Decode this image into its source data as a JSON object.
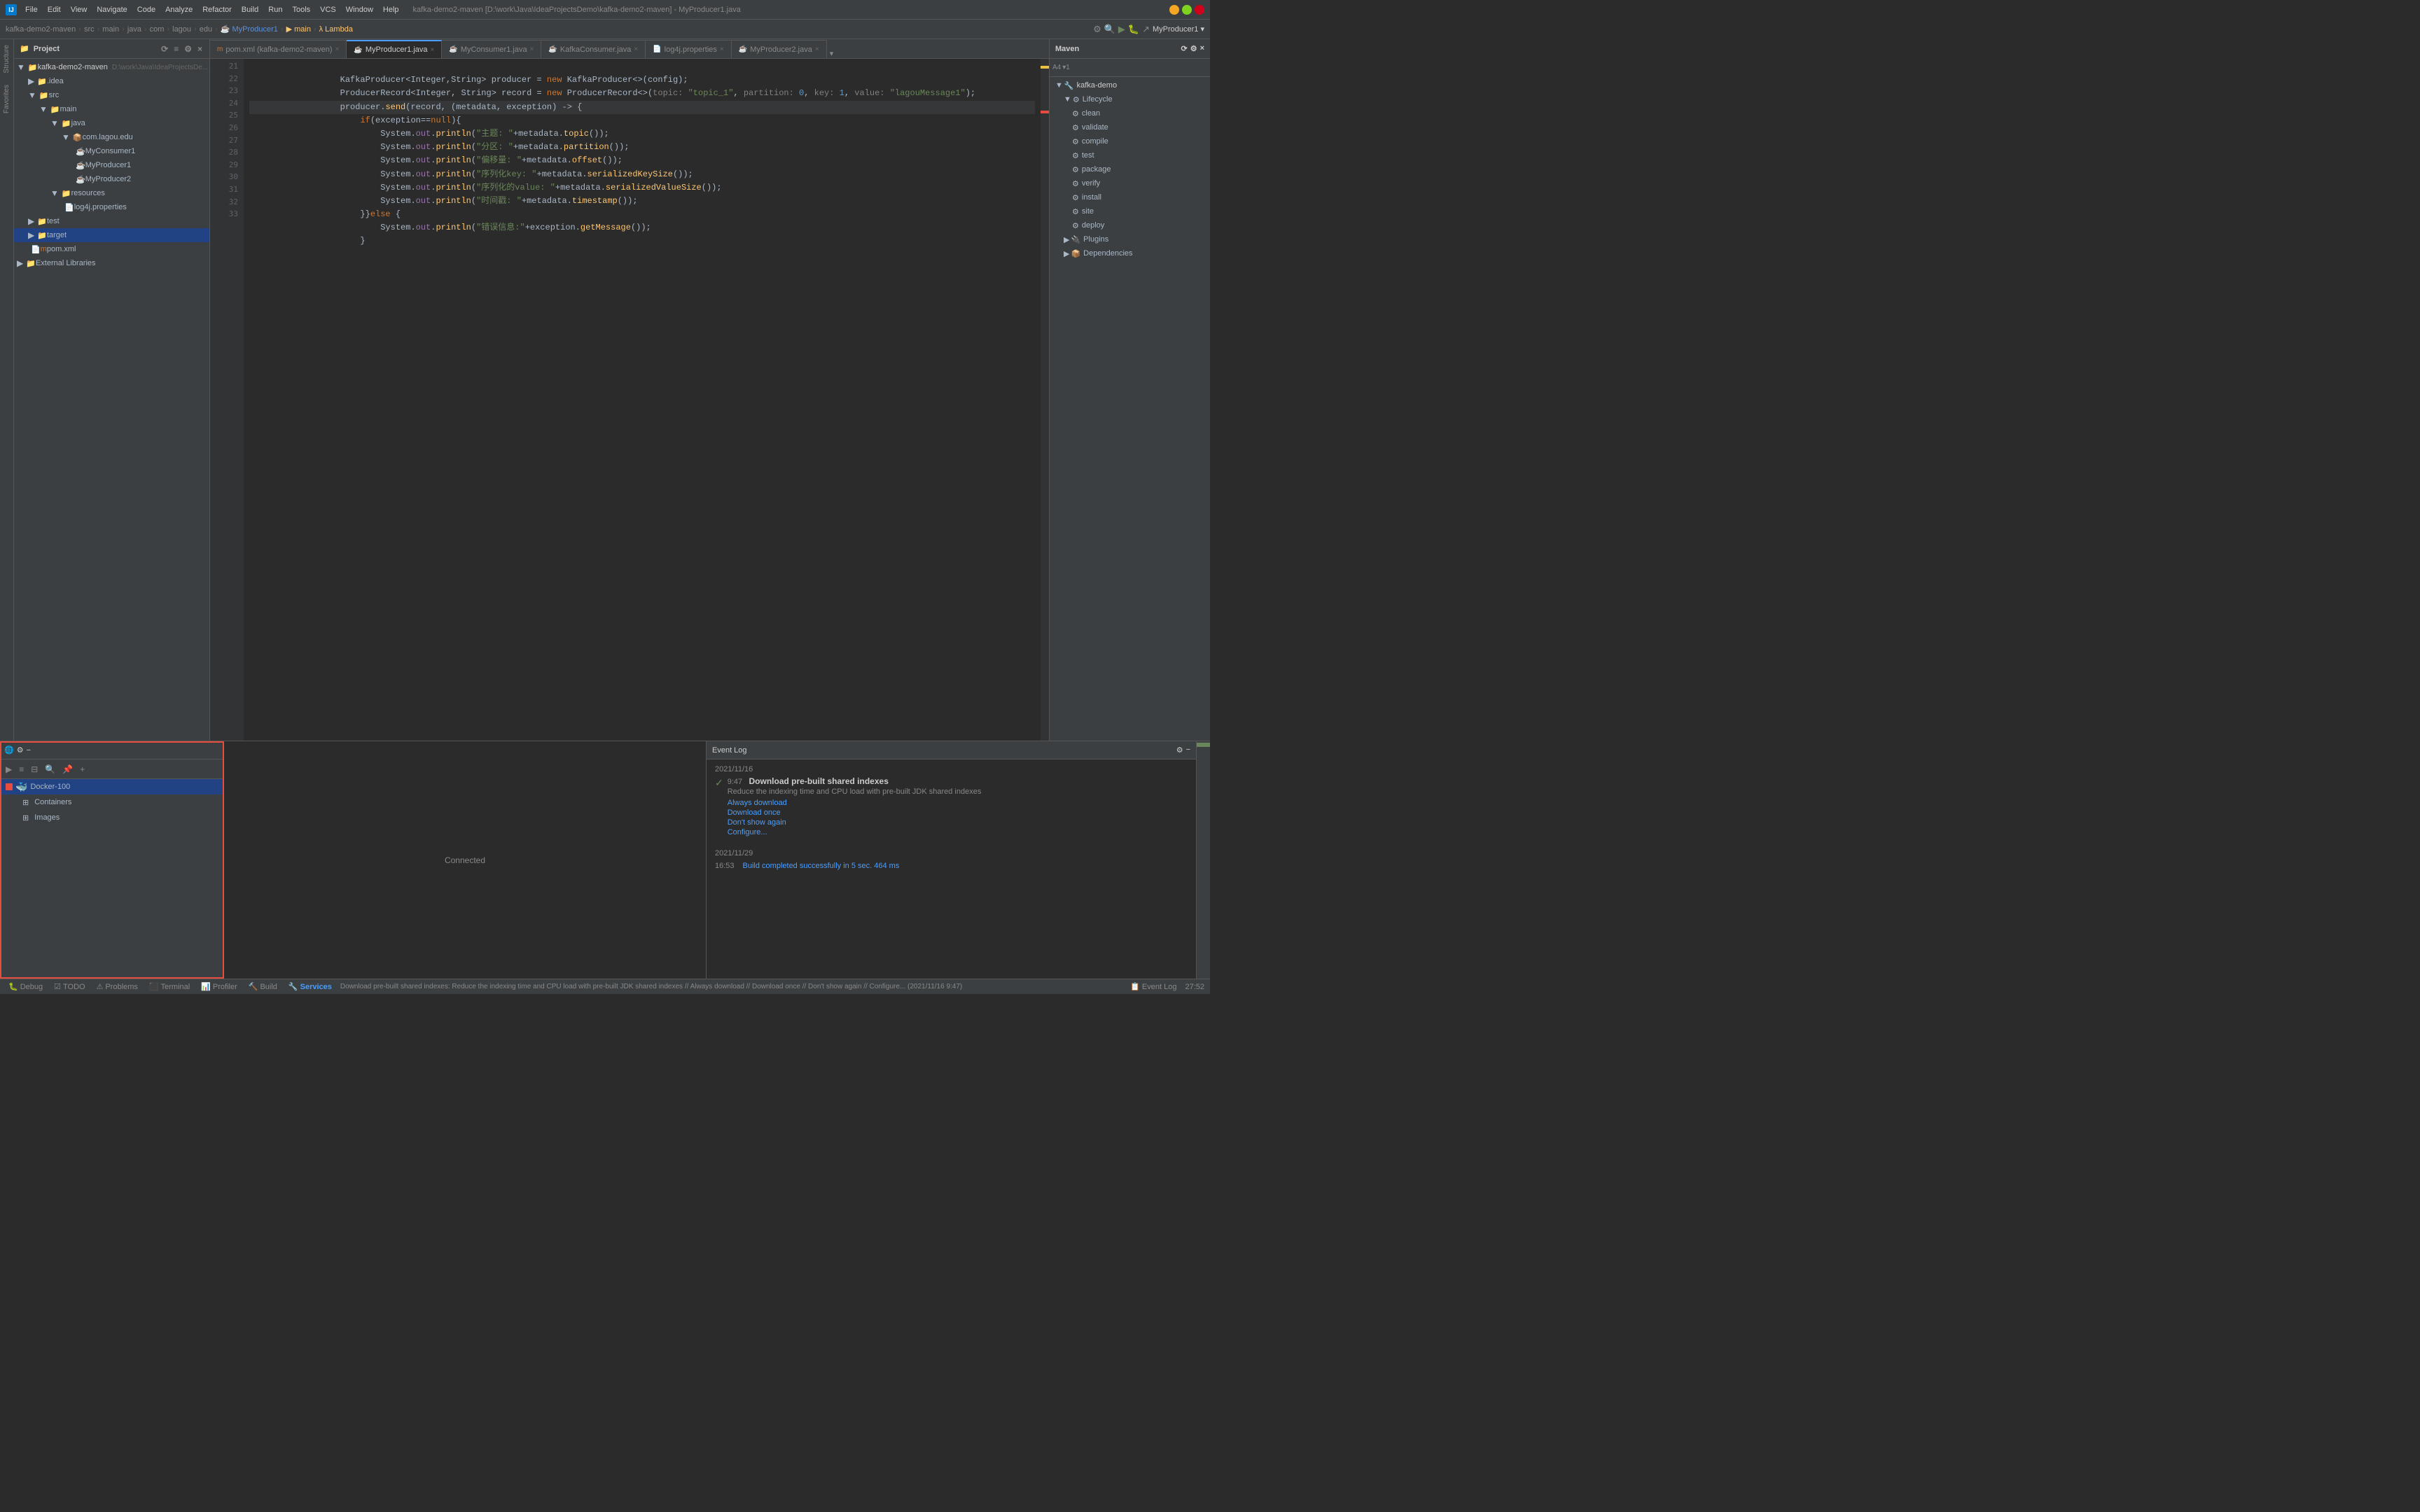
{
  "titleBar": {
    "logo": "IJ",
    "menus": [
      "File",
      "Edit",
      "View",
      "Navigate",
      "Code",
      "Analyze",
      "Refactor",
      "Build",
      "Run",
      "Tools",
      "VCS",
      "Window",
      "Help"
    ],
    "projectPath": "kafka-demo2-maven [D:\\work\\Java\\IdeaProjectsDemo\\kafka-demo2-maven] - MyProducer1.java",
    "controls": [
      "−",
      "□",
      "×"
    ]
  },
  "navBar": {
    "breadcrumbs": [
      "kafka-demo2-maven",
      "src",
      "main",
      "java",
      "com",
      "lagou",
      "edu",
      "MyProducer1",
      "main",
      "Lambda"
    ]
  },
  "tabs": [
    {
      "label": "pom.xml (kafka-demo2-maven)",
      "icon": "m",
      "active": false,
      "closable": true
    },
    {
      "label": "MyProducer1.java",
      "icon": "J",
      "active": true,
      "closable": true
    },
    {
      "label": "MyConsumer1.java",
      "icon": "J",
      "active": false,
      "closable": true
    },
    {
      "label": "KafkaConsumer.java",
      "icon": "J",
      "active": false,
      "closable": true
    },
    {
      "label": "log4j.properties",
      "icon": "P",
      "active": false,
      "closable": true
    },
    {
      "label": "MyProducer2.java",
      "icon": "J",
      "active": false,
      "closable": true
    }
  ],
  "editor": {
    "lines": [
      {
        "num": 21,
        "code": "        KafkaProducer<Integer,String> producer = new KafkaProducer<>(config);"
      },
      {
        "num": 22,
        "code": "        ProducerRecord<Integer, String> record = new ProducerRecord<>( topic: \"topic_1\", partition: 0, key: 1, value: \"lagouMessage1\");"
      },
      {
        "num": 23,
        "code": "        producer.send(record, (metadata, exception) -> {"
      },
      {
        "num": 24,
        "code": "            if(exception==null){",
        "highlighted": true
      },
      {
        "num": 25,
        "code": "                System.out.println(\"主题: \"+metadata.topic());"
      },
      {
        "num": 26,
        "code": "                System.out.println(\"分区: \"+metadata.partition());"
      },
      {
        "num": 27,
        "code": "                System.out.println(\"偏移量: \"+metadata.offset());"
      },
      {
        "num": 28,
        "code": "                System.out.println(\"序列化key: \"+metadata.serializedKeySize());"
      },
      {
        "num": 29,
        "code": "                System.out.println(\"序列化的value: \"+metadata.serializedValueSize());"
      },
      {
        "num": 30,
        "code": "                System.out.println(\"时间戳: \"+metadata.timestamp());"
      },
      {
        "num": 31,
        "code": "            }else {"
      },
      {
        "num": 32,
        "code": "                System.out.println(\"错误信息:\"+exception.getMessage());"
      },
      {
        "num": 33,
        "code": "            }"
      }
    ]
  },
  "projectTree": {
    "title": "Project",
    "items": [
      {
        "label": "kafka-demo2-maven",
        "level": 0,
        "type": "project",
        "expanded": true
      },
      {
        "label": ".idea",
        "level": 1,
        "type": "folder",
        "expanded": false
      },
      {
        "label": "src",
        "level": 1,
        "type": "folder",
        "expanded": true
      },
      {
        "label": "main",
        "level": 2,
        "type": "folder",
        "expanded": true
      },
      {
        "label": "java",
        "level": 3,
        "type": "folder",
        "expanded": true
      },
      {
        "label": "com.lagou.edu",
        "level": 4,
        "type": "package",
        "expanded": true
      },
      {
        "label": "MyConsumer1",
        "level": 5,
        "type": "java"
      },
      {
        "label": "MyProducer1",
        "level": 5,
        "type": "java"
      },
      {
        "label": "MyProducer2",
        "level": 5,
        "type": "java"
      },
      {
        "label": "resources",
        "level": 3,
        "type": "folder",
        "expanded": true
      },
      {
        "label": "log4j.properties",
        "level": 4,
        "type": "props"
      },
      {
        "label": "test",
        "level": 1,
        "type": "folder",
        "expanded": false
      },
      {
        "label": "target",
        "level": 1,
        "type": "folder",
        "expanded": false,
        "selected": true
      },
      {
        "label": "pom.xml",
        "level": 1,
        "type": "xml"
      },
      {
        "label": "External Libraries",
        "level": 0,
        "type": "folder",
        "expanded": false
      }
    ]
  },
  "mavenPanel": {
    "title": "Maven",
    "items": [
      {
        "label": "kafka-demo",
        "level": 0,
        "type": "maven",
        "expanded": true
      },
      {
        "label": "Lifecycle",
        "level": 1,
        "type": "folder",
        "expanded": false
      },
      {
        "label": "clean",
        "level": 2,
        "type": "goal"
      },
      {
        "label": "validate",
        "level": 2,
        "type": "goal"
      },
      {
        "label": "compile",
        "level": 2,
        "type": "goal"
      },
      {
        "label": "test",
        "level": 2,
        "type": "goal"
      },
      {
        "label": "package",
        "level": 2,
        "type": "goal"
      },
      {
        "label": "verify",
        "level": 2,
        "type": "goal"
      },
      {
        "label": "install",
        "level": 2,
        "type": "goal"
      },
      {
        "label": "site",
        "level": 2,
        "type": "goal"
      },
      {
        "label": "deploy",
        "level": 2,
        "type": "goal"
      },
      {
        "label": "Plugins",
        "level": 1,
        "type": "folder"
      },
      {
        "label": "Dependencies",
        "level": 1,
        "type": "folder"
      }
    ]
  },
  "servicesPanel": {
    "title": "Services",
    "items": [
      {
        "label": "Docker-100",
        "level": 0,
        "type": "docker",
        "expanded": true,
        "selected": true
      },
      {
        "label": "Containers",
        "level": 1,
        "type": "containers"
      },
      {
        "label": "Images",
        "level": 1,
        "type": "images"
      }
    ]
  },
  "eventLog": {
    "title": "Event Log",
    "entries": [
      {
        "date": "2021/11/16",
        "time": "9:47",
        "title": "Download pre-built shared indexes",
        "desc": "Reduce the indexing time and CPU load with pre-built JDK shared indexes",
        "links": [
          "Always download",
          "Download once",
          "Don't show again",
          "Configure..."
        ]
      },
      {
        "date": "2021/11/29",
        "time": "16:53",
        "title": "",
        "desc": "",
        "buildLink": "Build completed successfully in 5 sec. 464 ms"
      }
    ]
  },
  "statusBar": {
    "tabs": [
      {
        "label": "Debug",
        "icon": "🐛"
      },
      {
        "label": "TODO",
        "icon": "☑"
      },
      {
        "label": "Problems",
        "icon": "⚠"
      },
      {
        "label": "Terminal",
        "icon": "⬛"
      },
      {
        "label": "Profiler",
        "icon": "📊"
      },
      {
        "label": "Build",
        "icon": "🔨"
      },
      {
        "label": "Services",
        "icon": "🔧",
        "active": true
      }
    ],
    "rightTabs": [
      {
        "label": "Event Log",
        "icon": "📋"
      }
    ],
    "message": "Download pre-built shared indexes: Reduce the indexing time and CPU load with pre-built JDK shared indexes // Always download // Download once // Don't show again // Configure...  (2021/11/16 9:47)",
    "position": "27:52"
  }
}
